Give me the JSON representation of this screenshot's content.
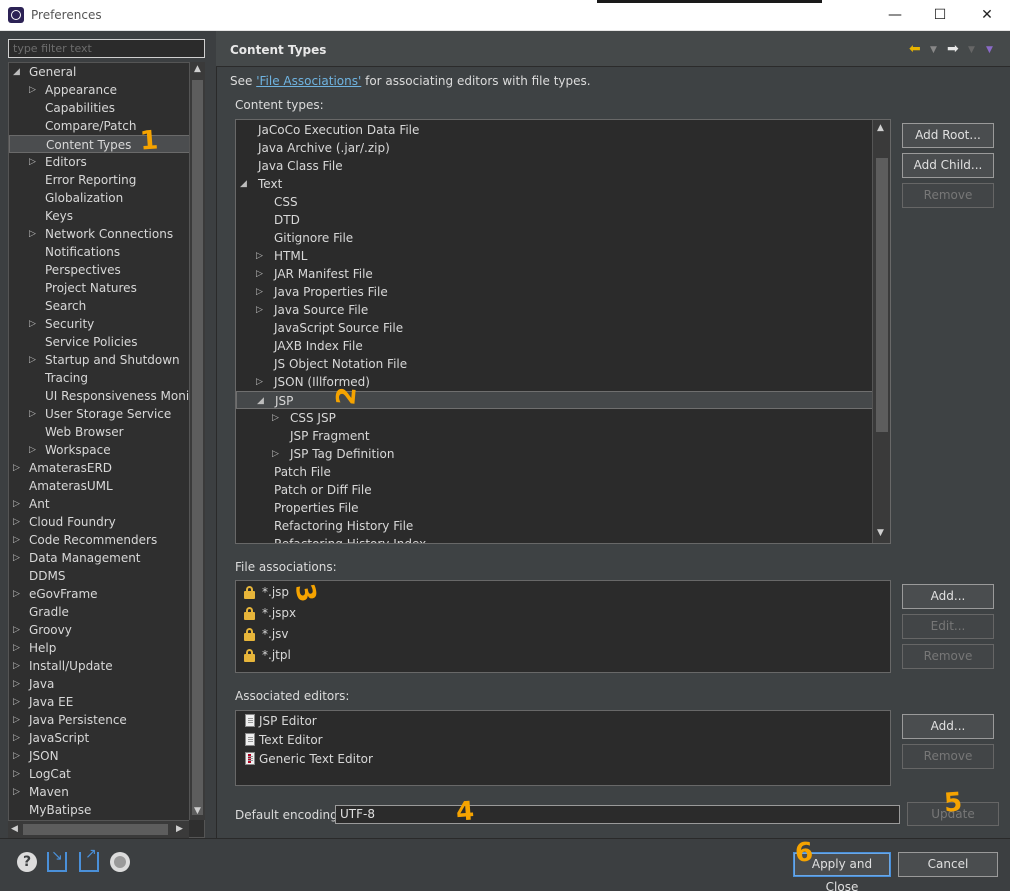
{
  "window": {
    "title": "Preferences",
    "minimize": "—",
    "maximize": "☐",
    "close": "✕"
  },
  "filter": {
    "placeholder": "type filter text"
  },
  "tree": [
    {
      "label": "General",
      "level": 0,
      "expander": "expanded"
    },
    {
      "label": "Appearance",
      "level": 1,
      "expander": "collapsed"
    },
    {
      "label": "Capabilities",
      "level": 1,
      "expander": "none"
    },
    {
      "label": "Compare/Patch",
      "level": 1,
      "expander": "none"
    },
    {
      "label": "Content Types",
      "level": 1,
      "expander": "none",
      "selected": true
    },
    {
      "label": "Editors",
      "level": 1,
      "expander": "collapsed"
    },
    {
      "label": "Error Reporting",
      "level": 1,
      "expander": "none"
    },
    {
      "label": "Globalization",
      "level": 1,
      "expander": "none"
    },
    {
      "label": "Keys",
      "level": 1,
      "expander": "none"
    },
    {
      "label": "Network Connections",
      "level": 1,
      "expander": "collapsed"
    },
    {
      "label": "Notifications",
      "level": 1,
      "expander": "none"
    },
    {
      "label": "Perspectives",
      "level": 1,
      "expander": "none"
    },
    {
      "label": "Project Natures",
      "level": 1,
      "expander": "none"
    },
    {
      "label": "Search",
      "level": 1,
      "expander": "none"
    },
    {
      "label": "Security",
      "level": 1,
      "expander": "collapsed"
    },
    {
      "label": "Service Policies",
      "level": 1,
      "expander": "none"
    },
    {
      "label": "Startup and Shutdown",
      "level": 1,
      "expander": "collapsed"
    },
    {
      "label": "Tracing",
      "level": 1,
      "expander": "none"
    },
    {
      "label": "UI Responsiveness Monitor",
      "level": 1,
      "expander": "none"
    },
    {
      "label": "User Storage Service",
      "level": 1,
      "expander": "collapsed"
    },
    {
      "label": "Web Browser",
      "level": 1,
      "expander": "none"
    },
    {
      "label": "Workspace",
      "level": 1,
      "expander": "collapsed"
    },
    {
      "label": "AmaterasERD",
      "level": 0,
      "expander": "collapsed"
    },
    {
      "label": "AmaterasUML",
      "level": 0,
      "expander": "none"
    },
    {
      "label": "Ant",
      "level": 0,
      "expander": "collapsed"
    },
    {
      "label": "Cloud Foundry",
      "level": 0,
      "expander": "collapsed"
    },
    {
      "label": "Code Recommenders",
      "level": 0,
      "expander": "collapsed"
    },
    {
      "label": "Data Management",
      "level": 0,
      "expander": "collapsed"
    },
    {
      "label": "DDMS",
      "level": 0,
      "expander": "none"
    },
    {
      "label": "eGovFrame",
      "level": 0,
      "expander": "collapsed"
    },
    {
      "label": "Gradle",
      "level": 0,
      "expander": "none"
    },
    {
      "label": "Groovy",
      "level": 0,
      "expander": "collapsed"
    },
    {
      "label": "Help",
      "level": 0,
      "expander": "collapsed"
    },
    {
      "label": "Install/Update",
      "level": 0,
      "expander": "collapsed"
    },
    {
      "label": "Java",
      "level": 0,
      "expander": "collapsed"
    },
    {
      "label": "Java EE",
      "level": 0,
      "expander": "collapsed"
    },
    {
      "label": "Java Persistence",
      "level": 0,
      "expander": "collapsed"
    },
    {
      "label": "JavaScript",
      "level": 0,
      "expander": "collapsed"
    },
    {
      "label": "JSON",
      "level": 0,
      "expander": "collapsed"
    },
    {
      "label": "LogCat",
      "level": 0,
      "expander": "collapsed"
    },
    {
      "label": "Maven",
      "level": 0,
      "expander": "collapsed"
    },
    {
      "label": "MyBatipse",
      "level": 0,
      "expander": "none"
    }
  ],
  "page": {
    "title": "Content Types",
    "see_prefix": "See ",
    "see_link": "'File Associations'",
    "see_suffix": " for associating editors with file types.",
    "content_types_label": "Content types:",
    "file_associations_label": "File associations:",
    "associated_editors_label": "Associated editors:",
    "default_encoding_label": "Default encoding:",
    "default_encoding_value": "UTF-8"
  },
  "content_types": [
    {
      "label": "JaCoCo Execution Data File",
      "level": 0,
      "expander": "none"
    },
    {
      "label": "Java Archive (.jar/.zip)",
      "level": 0,
      "expander": "none"
    },
    {
      "label": "Java Class File",
      "level": 0,
      "expander": "none"
    },
    {
      "label": "Text",
      "level": 0,
      "expander": "expanded"
    },
    {
      "label": "CSS",
      "level": 1,
      "expander": "none"
    },
    {
      "label": "DTD",
      "level": 1,
      "expander": "none"
    },
    {
      "label": "Gitignore File",
      "level": 1,
      "expander": "none"
    },
    {
      "label": "HTML",
      "level": 1,
      "expander": "collapsed"
    },
    {
      "label": "JAR Manifest File",
      "level": 1,
      "expander": "collapsed"
    },
    {
      "label": "Java Properties File",
      "level": 1,
      "expander": "collapsed"
    },
    {
      "label": "Java Source File",
      "level": 1,
      "expander": "collapsed"
    },
    {
      "label": "JavaScript Source File",
      "level": 1,
      "expander": "none"
    },
    {
      "label": "JAXB Index File",
      "level": 1,
      "expander": "none"
    },
    {
      "label": "JS Object Notation File",
      "level": 1,
      "expander": "none"
    },
    {
      "label": "JSON (Illformed)",
      "level": 1,
      "expander": "collapsed"
    },
    {
      "label": "JSP",
      "level": 1,
      "expander": "expanded",
      "selected": true
    },
    {
      "label": "CSS JSP",
      "level": 2,
      "expander": "collapsed"
    },
    {
      "label": "JSP Fragment",
      "level": 2,
      "expander": "none"
    },
    {
      "label": "JSP Tag Definition",
      "level": 2,
      "expander": "collapsed"
    },
    {
      "label": "Patch File",
      "level": 1,
      "expander": "none"
    },
    {
      "label": "Patch or Diff File",
      "level": 1,
      "expander": "none"
    },
    {
      "label": "Properties File",
      "level": 1,
      "expander": "none"
    },
    {
      "label": "Refactoring History File",
      "level": 1,
      "expander": "none"
    },
    {
      "label": "Refactoring History Index",
      "level": 1,
      "expander": "none"
    }
  ],
  "file_associations": [
    "*.jsp",
    "*.jspx",
    "*.jsv",
    "*.jtpl"
  ],
  "associated_editors": [
    {
      "label": "JSP Editor",
      "icon": "doc-icon"
    },
    {
      "label": "Text Editor",
      "icon": "doc-icon"
    },
    {
      "label": "Generic Text Editor",
      "icon": "generic-editor-icon"
    }
  ],
  "buttons": {
    "add_root": "Add Root...",
    "add_child": "Add Child...",
    "remove_ct": "Remove",
    "add_fa": "Add...",
    "edit_fa": "Edit...",
    "remove_fa": "Remove",
    "add_ed": "Add...",
    "remove_ed": "Remove",
    "update": "Update",
    "apply_close": "Apply and Close",
    "cancel": "Cancel"
  },
  "annotations": [
    "1",
    "2",
    "3",
    "4",
    "5",
    "6"
  ],
  "colors": {
    "annotation": "#f5a300",
    "background": "#3c3f41",
    "link": "#6fb3e0"
  }
}
